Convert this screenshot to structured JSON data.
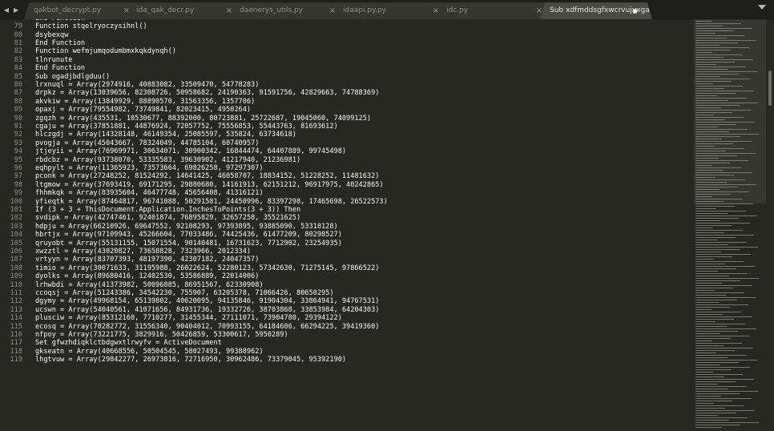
{
  "tabs": [
    {
      "label": "qakbot_decrypt.py",
      "close": "×"
    },
    {
      "label": "ida_qak_decr.py",
      "close": "×"
    },
    {
      "label": "daenerys_utils.py",
      "close": "×"
    },
    {
      "label": "idaapi.py.py",
      "close": "×"
    },
    {
      "label": "idc.py",
      "close": "×"
    },
    {
      "label": "Sub xdfmddsgfxwcrvujvxgadb()",
      "close": "●",
      "active": true
    }
  ],
  "nav": {
    "back": "◀",
    "forward": "▶"
  },
  "lines": [
    {
      "n": "",
      "t": "End Function"
    },
    {
      "n": "79",
      "t": "Function stqelryoczysihnl()"
    },
    {
      "n": "80",
      "t": "dsybexqw"
    },
    {
      "n": "81",
      "t": "End Function"
    },
    {
      "n": "82",
      "t": "Function wefmjumqodumbmxkqkdynqh()"
    },
    {
      "n": "83",
      "t": "tlnrunute"
    },
    {
      "n": "84",
      "t": "End Function"
    },
    {
      "n": "85",
      "t": "Sub ogadjbdlgduu()"
    },
    {
      "n": "86",
      "t": "lrxnuql = Array(2974916, 40883082, 33509470, 54778283)"
    },
    {
      "n": "87",
      "t": "drpkz = Array(13039656, 82308726, 50958682, 24190363, 91591756, 42829663, 74788369)"
    },
    {
      "n": "88",
      "t": "akvkiw = Array(13849929, 88890570, 31563356, 1357706)"
    },
    {
      "n": "89",
      "t": "opaxj = Array(79554982, 73749841, 82023415, 4950264)"
    },
    {
      "n": "90",
      "t": "zgqzh = Array(435531, 10530677, 88392000, 80723881, 25722687, 19045060, 74099125)"
    },
    {
      "n": "91",
      "t": "cgaju = Array(37851881, 44876924, 72057752, 75556853, 55443763, 81693612)"
    },
    {
      "n": "92",
      "t": "hlczgdj = Array(14328148, 46149354, 25085597, 535824, 63734618)"
    },
    {
      "n": "93",
      "t": "pvogja = Array(45043667, 78324049, 44785104, 60740957)"
    },
    {
      "n": "94",
      "t": "jtjeyii = Array(76969971, 30634071, 30900342, 16844474, 64407889, 99745498)"
    },
    {
      "n": "95",
      "t": "rbdcbz = Array(93738070, 53335583, 39630902, 41217940, 21236981)"
    },
    {
      "n": "96",
      "t": "eqhpylt = Array(11365923, 73573664, 69826258, 97297307)"
    },
    {
      "n": "97",
      "t": "pconk = Array(27248252, 81524292, 14641425, 46058707, 18834152, 51228252, 11481632)"
    },
    {
      "n": "98",
      "t": "ltgmow = Array(37693419, 69171295, 29880680, 14161913, 62151212, 96917975, 40242865)"
    },
    {
      "n": "99",
      "t": "fhhmkqk = Array(83935604, 46477748, 45656408, 41316121)"
    },
    {
      "n": "100",
      "t": "yfieqtk = Array(87464817, 96741088, 50291581, 24450996, 83397298, 17465698, 26522573)"
    },
    {
      "n": "101",
      "t": "If (3 + 3 + ThisDocument.Application.InchesToPoints(3 + 3)) Then"
    },
    {
      "n": "102",
      "t": "svdipk = Array(42747461, 92401874, 76895829, 32657258, 35521625)"
    },
    {
      "n": "103",
      "t": "hdpju = Array(66210926, 69647552, 92108293, 97393895, 93885090, 53318128)"
    },
    {
      "n": "104",
      "t": "hbrtjx = Array(97109943, 45266604, 77033486, 74425436, 61477209, 80298527)"
    },
    {
      "n": "105",
      "t": "qruyobt = Array(55131155, 15071554, 90140481, 16731623, 7712902, 23254935)"
    },
    {
      "n": "106",
      "t": "xwzztl = Array(43020827, 73658828, 7323966, 2012334)"
    },
    {
      "n": "107",
      "t": "vrtyyn = Array(83707393, 48197390, 42307182, 24047357)"
    },
    {
      "n": "108",
      "t": "timio = Array(30071633, 31195988, 26022624, 52280123, 57342630, 71275145, 97866522)"
    },
    {
      "n": "109",
      "t": "dyolks = Array(89680416, 12402530, 53586889, 22014006)"
    },
    {
      "n": "110",
      "t": "lrhwbdi = Array(41373982, 50096885, 86951567, 62330908)"
    },
    {
      "n": "111",
      "t": "ccoqsj = Array(51243386, 34542230, 755907, 63205378, 71066426, 80650295)"
    },
    {
      "n": "112",
      "t": "dgymy = Array(49968154, 65139802, 40620095, 94135846, 91904304, 33864941, 94767531)"
    },
    {
      "n": "113",
      "t": "ucswn = Array(54040561, 41071656, 84931736, 19332726, 38703868, 33853984, 64204303)"
    },
    {
      "n": "114",
      "t": "plusciw = Array(85312160, 7710277, 31455344, 27111071, 73904780, 29394122)"
    },
    {
      "n": "115",
      "t": "ecosq = Array(70282772, 31556340, 90404012, 70993155, 64184606, 66294225, 39419360)"
    },
    {
      "n": "116",
      "t": "nfpoy = Array(73221775, 3829916, 50426859, 53300617, 5950289)"
    },
    {
      "n": "117",
      "t": "Set gfwzhdiqklctbdgwxtlrwyfv = ActiveDocument"
    },
    {
      "n": "118",
      "t": "gkseatn = Array(40668556, 50504545, 58027493, 99388962)"
    },
    {
      "n": "119",
      "t": "lhgtvuw = Array(29842277, 26973816, 72716950, 30962486, 73379045, 95392190)"
    }
  ]
}
